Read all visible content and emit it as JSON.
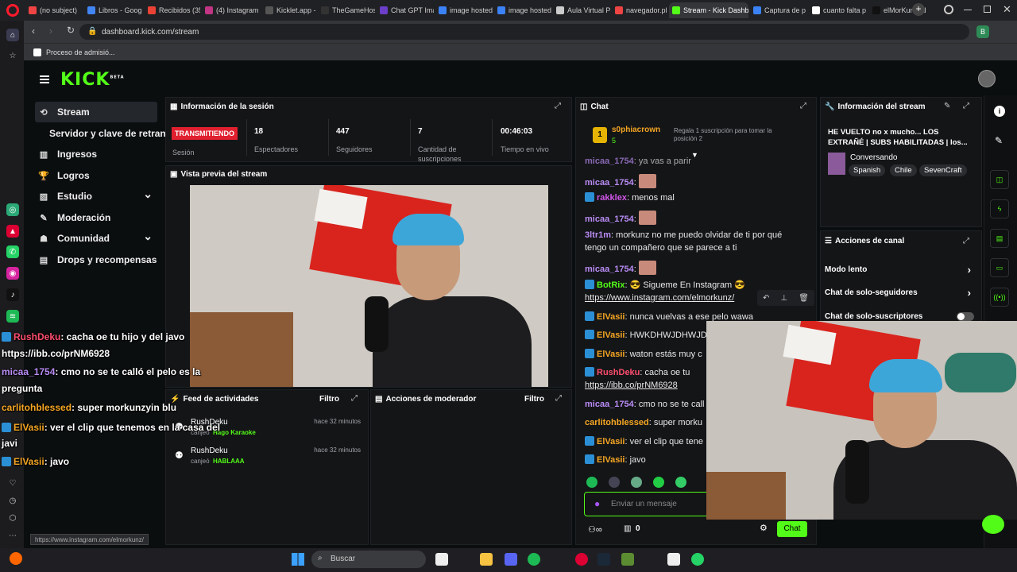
{
  "browser": {
    "tabs": [
      {
        "label": "(no subject)",
        "color": "#e44"
      },
      {
        "label": "Libros - Goog",
        "color": "#4285f4"
      },
      {
        "label": "Recibidos (35",
        "color": "#ea4335"
      },
      {
        "label": "(4) Instagram",
        "color": "#c13584"
      },
      {
        "label": "Kicklet.app -",
        "color": "#555"
      },
      {
        "label": "TheGameHos",
        "color": "#333"
      },
      {
        "label": "Chat GPT Ima",
        "color": "#6b3ec7"
      },
      {
        "label": "image hosted",
        "color": "#3b82f6"
      },
      {
        "label": "image hosted",
        "color": "#3b82f6"
      },
      {
        "label": "Aula Virtual P",
        "color": "#ccc"
      },
      {
        "label": "navegador.pl",
        "color": "#e44"
      },
      {
        "label": "Stream - Kick Dashboa",
        "color": "#53fc18"
      },
      {
        "label": "Captura de p",
        "color": "#3b82f6"
      },
      {
        "label": "cuanto falta p",
        "color": "#fff"
      },
      {
        "label": "elMorKunz (d",
        "color": "#111"
      }
    ],
    "new_tab": "+",
    "url": "dashboard.kick.com/stream",
    "bookmark": "Proceso de admisió..."
  },
  "app": {
    "logo": "KICK",
    "logo_sup": "BETA"
  },
  "nav": {
    "items": [
      {
        "label": "Stream",
        "icon": "stream-icon"
      },
      {
        "label": "Servidor y clave de retransm",
        "icon": ""
      },
      {
        "label": "Ingresos",
        "icon": "money-icon"
      },
      {
        "label": "Logros",
        "icon": "trophy-icon"
      },
      {
        "label": "Estudio",
        "icon": "studio-icon"
      },
      {
        "label": "Moderación",
        "icon": "wrench-icon"
      },
      {
        "label": "Comunidad",
        "icon": "community-icon"
      },
      {
        "label": "Drops y recompensas",
        "icon": "gift-icon"
      }
    ]
  },
  "session": {
    "title": "Información de la sesión",
    "live_badge": "TRANSMITIENDO",
    "session_label": "Sesión",
    "stats": [
      {
        "value": "18",
        "label": "Espectadores"
      },
      {
        "value": "447",
        "label": "Seguidores"
      },
      {
        "value": "7",
        "label": "Cantidad de suscripciones"
      },
      {
        "value": "00:46:03",
        "label": "Tiempo en vivo"
      }
    ]
  },
  "preview": {
    "title": "Vista previa del stream"
  },
  "activity": {
    "title": "Feed de actividades",
    "filter": "Filtro",
    "items": [
      {
        "user": "RushDeku",
        "action": "canjeó",
        "reward": "Hago Karaoke",
        "time": "hace 32 minutos"
      },
      {
        "user": "RushDeku",
        "action": "canjeó",
        "reward": "HABLAAA",
        "time": "hace 32 minutos"
      }
    ]
  },
  "modactions": {
    "title": "Acciones de moderador",
    "filter": "Filtro"
  },
  "chat": {
    "title": "Chat",
    "pinned_user": "s0phiacrown",
    "pinned_count": "5",
    "pinned_text": "Regala 1 suscripción para tomar la posición 2",
    "pinned_rank": "1",
    "messages": [
      {
        "user": "micaa_1754",
        "color": "#b98cf5",
        "text": "ya vas a parir",
        "emote": false
      },
      {
        "user": "micaa_1754",
        "color": "#b98cf5",
        "text": "",
        "emote": true
      },
      {
        "user": "rakklex",
        "color": "#d056e8",
        "text": "menos mal",
        "emote": false,
        "badge": true
      },
      {
        "user": "micaa_1754",
        "color": "#b98cf5",
        "text": "",
        "emote": true
      },
      {
        "user": "3ltr1m",
        "color": "#b98cf5",
        "text": "morkunz no me puedo olvidar de ti por qué",
        "emote": false
      },
      {
        "user": "",
        "color": "#fff",
        "text": "tengo un compañero que se parece a ti",
        "emote": false
      },
      {
        "user": "micaa_1754",
        "color": "#b98cf5",
        "text": "",
        "emote": true
      },
      {
        "user": "BotRix",
        "color": "#53fc18",
        "text": "😎 Sigueme En Instagram 😎",
        "emote": false,
        "badge": true
      },
      {
        "user": "",
        "color": "#fff",
        "text": "https://www.instagram.com/elmorkunz/",
        "emote": false
      },
      {
        "user": "ElVasii",
        "color": "#f5a623",
        "text": "nunca vuelvas a ese pelo wawa",
        "emote": false,
        "badge": true
      },
      {
        "user": "ElVasii",
        "color": "#f5a623",
        "text": "HWKDHWJDHWJD",
        "emote": false,
        "badge": true
      },
      {
        "user": "ElVasii",
        "color": "#f5a623",
        "text": "waton estás muy c",
        "emote": false,
        "badge": true
      },
      {
        "user": "RushDeku",
        "color": "#ff4d6d",
        "text": "cacha oe tu",
        "emote": false,
        "badge": true
      },
      {
        "user": "",
        "color": "#fff",
        "text": "https://ibb.co/prNM6928",
        "emote": false
      },
      {
        "user": "micaa_1754",
        "color": "#b98cf5",
        "text": "cmo no se te call",
        "emote": false
      },
      {
        "user": "carlitohblessed",
        "color": "#f5a623",
        "text": "super morku",
        "emote": false
      },
      {
        "user": "ElVasii",
        "color": "#f5a623",
        "text": "ver el clip que tene",
        "emote": false,
        "badge": true
      },
      {
        "user": "ElVasii",
        "color": "#f5a623",
        "text": "javo",
        "emote": false,
        "badge": true
      }
    ],
    "input_placeholder": "Enviar un mensaje",
    "points": "0",
    "send_button": "Chat"
  },
  "streaminfo": {
    "title": "Información del stream",
    "stream_title": "HE VUELTO no x mucho... LOS EXTRAÑÉ | SUBS HABILITADAS | los...",
    "category": "Conversando",
    "tags": [
      "Spanish",
      "Chile",
      "SevenCraft"
    ]
  },
  "channel_actions": {
    "title": "Acciones de canal",
    "items": [
      "Modo lento",
      "Chat de solo-seguidores",
      "Chat de solo-suscriptores"
    ]
  },
  "overlay_chat": [
    {
      "user": "RushDeku",
      "color": "#ff4d6d",
      "text": ": cacha oe tu hijo y del javo"
    },
    {
      "user": "",
      "color": "#fff",
      "text": "https://ibb.co/prNM6928"
    },
    {
      "user": "micaa_1754",
      "color": "#b98cf5",
      "text": ": cmo no se te calló el pelo es la"
    },
    {
      "user": "",
      "color": "#fff",
      "text": "pregunta"
    },
    {
      "user": "carlitohblessed",
      "color": "#f5a623",
      "text": ": super morkunzyin blu"
    },
    {
      "user": "ElVasii",
      "color": "#f5a623",
      "text": ": ver el clip que tenemos en la casa del"
    },
    {
      "user": "",
      "color": "#fff",
      "text": "javi"
    },
    {
      "user": "ElVasii",
      "color": "#f5a623",
      "text": ": javo"
    }
  ],
  "statusbar": {
    "link": "https://www.instagram.com/elmorkunz/"
  },
  "taskbar": {
    "search_placeholder": "Buscar"
  }
}
